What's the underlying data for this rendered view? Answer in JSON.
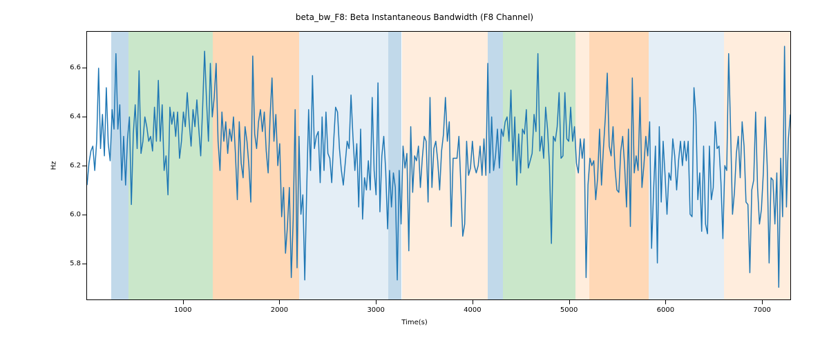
{
  "chart_data": {
    "type": "line",
    "title": "beta_bw_F8: Beta Instantaneous Bandwidth (F8 Channel)",
    "xlabel": "Time(s)",
    "ylabel": "Hz",
    "xlim": [
      0,
      7300
    ],
    "ylim": [
      5.65,
      6.75
    ],
    "xticks": [
      1000,
      2000,
      3000,
      4000,
      5000,
      6000,
      7000
    ],
    "yticks": [
      5.8,
      6.0,
      6.2,
      6.4,
      6.6
    ],
    "background_regions": [
      {
        "x0": 250,
        "x1": 430,
        "class": "blue"
      },
      {
        "x0": 430,
        "x1": 1300,
        "class": "green"
      },
      {
        "x0": 1300,
        "x1": 2200,
        "class": "orange"
      },
      {
        "x0": 2200,
        "x1": 3120,
        "class": "lblue"
      },
      {
        "x0": 3120,
        "x1": 3260,
        "class": "blue"
      },
      {
        "x0": 3260,
        "x1": 4150,
        "class": "lorange"
      },
      {
        "x0": 4150,
        "x1": 4310,
        "class": "blue"
      },
      {
        "x0": 4310,
        "x1": 5060,
        "class": "green"
      },
      {
        "x0": 5060,
        "x1": 5200,
        "class": "lorange"
      },
      {
        "x0": 5200,
        "x1": 5820,
        "class": "orange"
      },
      {
        "x0": 5820,
        "x1": 6600,
        "class": "lblue"
      },
      {
        "x0": 6600,
        "x1": 7290,
        "class": "lorange"
      }
    ],
    "series": [
      {
        "name": "beta_bw_F8",
        "x_step": 20,
        "x_start": 0,
        "values": [
          6.12,
          6.21,
          6.26,
          6.28,
          6.18,
          6.3,
          6.6,
          6.27,
          6.41,
          6.24,
          6.52,
          6.29,
          6.22,
          6.43,
          6.35,
          6.66,
          6.35,
          6.45,
          6.14,
          6.32,
          6.12,
          6.31,
          6.4,
          6.04,
          6.33,
          6.45,
          6.27,
          6.59,
          6.25,
          6.3,
          6.4,
          6.36,
          6.3,
          6.32,
          6.26,
          6.44,
          6.3,
          6.55,
          6.3,
          6.45,
          6.18,
          6.24,
          6.08,
          6.44,
          6.37,
          6.42,
          6.32,
          6.42,
          6.23,
          6.3,
          6.42,
          6.36,
          6.5,
          6.38,
          6.28,
          6.43,
          6.36,
          6.47,
          6.35,
          6.24,
          6.44,
          6.67,
          6.47,
          6.3,
          6.62,
          6.4,
          6.48,
          6.62,
          6.3,
          6.18,
          6.42,
          6.3,
          6.38,
          6.25,
          6.35,
          6.3,
          6.4,
          6.25,
          6.06,
          6.38,
          6.21,
          6.15,
          6.36,
          6.3,
          6.2,
          6.05,
          6.65,
          6.33,
          6.27,
          6.38,
          6.43,
          6.34,
          6.42,
          6.26,
          6.17,
          6.4,
          6.56,
          6.3,
          6.41,
          6.2,
          6.29,
          5.99,
          6.11,
          5.84,
          5.95,
          6.11,
          5.74,
          5.98,
          6.43,
          5.78,
          6.32,
          6.0,
          6.08,
          5.73,
          6.1,
          6.43,
          6.18,
          6.57,
          6.27,
          6.32,
          6.34,
          6.13,
          6.4,
          6.18,
          6.42,
          6.25,
          6.23,
          6.13,
          6.3,
          6.44,
          6.42,
          6.27,
          6.18,
          6.12,
          6.21,
          6.3,
          6.27,
          6.49,
          6.32,
          6.18,
          6.29,
          6.03,
          6.35,
          5.98,
          6.15,
          6.1,
          6.22,
          6.1,
          6.48,
          6.18,
          6.08,
          6.54,
          6.01,
          6.24,
          6.32,
          6.18,
          5.94,
          6.18,
          6.03,
          6.17,
          6.11,
          5.73,
          6.18,
          5.96,
          6.28,
          6.19,
          6.25,
          5.85,
          6.36,
          6.09,
          6.24,
          6.22,
          6.28,
          6.11,
          6.23,
          6.32,
          6.3,
          6.05,
          6.48,
          6.11,
          6.27,
          6.3,
          6.22,
          6.1,
          6.26,
          6.33,
          6.48,
          6.3,
          6.38,
          5.95,
          6.23,
          6.23,
          6.23,
          6.32,
          6.12,
          5.91,
          5.96,
          6.3,
          6.16,
          6.19,
          6.3,
          6.2,
          6.17,
          6.2,
          6.28,
          6.16,
          6.31,
          6.16,
          6.62,
          6.17,
          6.4,
          6.18,
          6.24,
          6.35,
          6.19,
          6.35,
          6.32,
          6.38,
          6.4,
          6.3,
          6.51,
          6.22,
          6.4,
          6.12,
          6.33,
          6.17,
          6.35,
          6.33,
          6.43,
          6.19,
          6.22,
          6.25,
          6.41,
          6.34,
          6.66,
          6.26,
          6.32,
          6.23,
          6.44,
          6.35,
          6.2,
          5.88,
          6.32,
          6.3,
          6.36,
          6.5,
          6.23,
          6.24,
          6.5,
          6.31,
          6.3,
          6.44,
          6.3,
          6.36,
          6.21,
          6.17,
          6.31,
          6.23,
          6.31,
          5.74,
          6.12,
          6.23,
          6.2,
          6.22,
          6.06,
          6.15,
          6.35,
          6.12,
          6.27,
          6.4,
          6.58,
          6.28,
          6.24,
          6.36,
          6.19,
          6.1,
          6.09,
          6.26,
          6.32,
          6.2,
          6.03,
          6.35,
          5.95,
          6.56,
          6.17,
          6.24,
          6.18,
          6.48,
          6.11,
          6.2,
          6.32,
          6.24,
          6.38,
          5.86,
          6.09,
          6.28,
          5.8,
          6.36,
          6.05,
          6.3,
          6.16,
          6.0,
          6.17,
          6.14,
          6.31,
          6.24,
          6.1,
          6.22,
          6.3,
          6.2,
          6.3,
          6.22,
          6.3,
          6.0,
          5.99,
          6.52,
          6.41,
          6.06,
          6.17,
          5.93,
          6.28,
          5.96,
          5.92,
          6.28,
          6.06,
          6.11,
          6.38,
          6.27,
          6.28,
          6.13,
          5.9,
          6.2,
          6.18,
          6.66,
          6.35,
          6.0,
          6.09,
          6.25,
          6.32,
          6.15,
          6.38,
          6.28,
          6.05,
          6.04,
          5.76,
          6.1,
          6.14,
          6.42,
          6.11,
          5.96,
          6.02,
          6.17,
          6.4,
          6.2,
          5.8,
          6.15,
          6.14,
          5.96,
          6.17,
          5.7,
          6.23,
          5.99,
          6.69,
          6.03,
          6.31,
          6.41
        ]
      }
    ]
  }
}
